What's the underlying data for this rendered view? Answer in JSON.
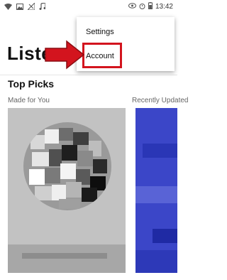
{
  "status_bar": {
    "time": "13:42",
    "left_icons": [
      "wifi-icon",
      "image-icon",
      "no-signal-icon",
      "music-icon"
    ],
    "right_icons": [
      "eye-icon",
      "alarm-icon",
      "battery-icon"
    ]
  },
  "page": {
    "title": "Listen",
    "section_title": "Top Picks",
    "cards": [
      {
        "label": "Made for You"
      },
      {
        "label": "Recently Updated"
      }
    ]
  },
  "overflow_menu": {
    "items": [
      {
        "label": "Settings"
      },
      {
        "label": "Account"
      }
    ]
  },
  "annotation": {
    "color": "#d3141e",
    "target": "Account"
  }
}
